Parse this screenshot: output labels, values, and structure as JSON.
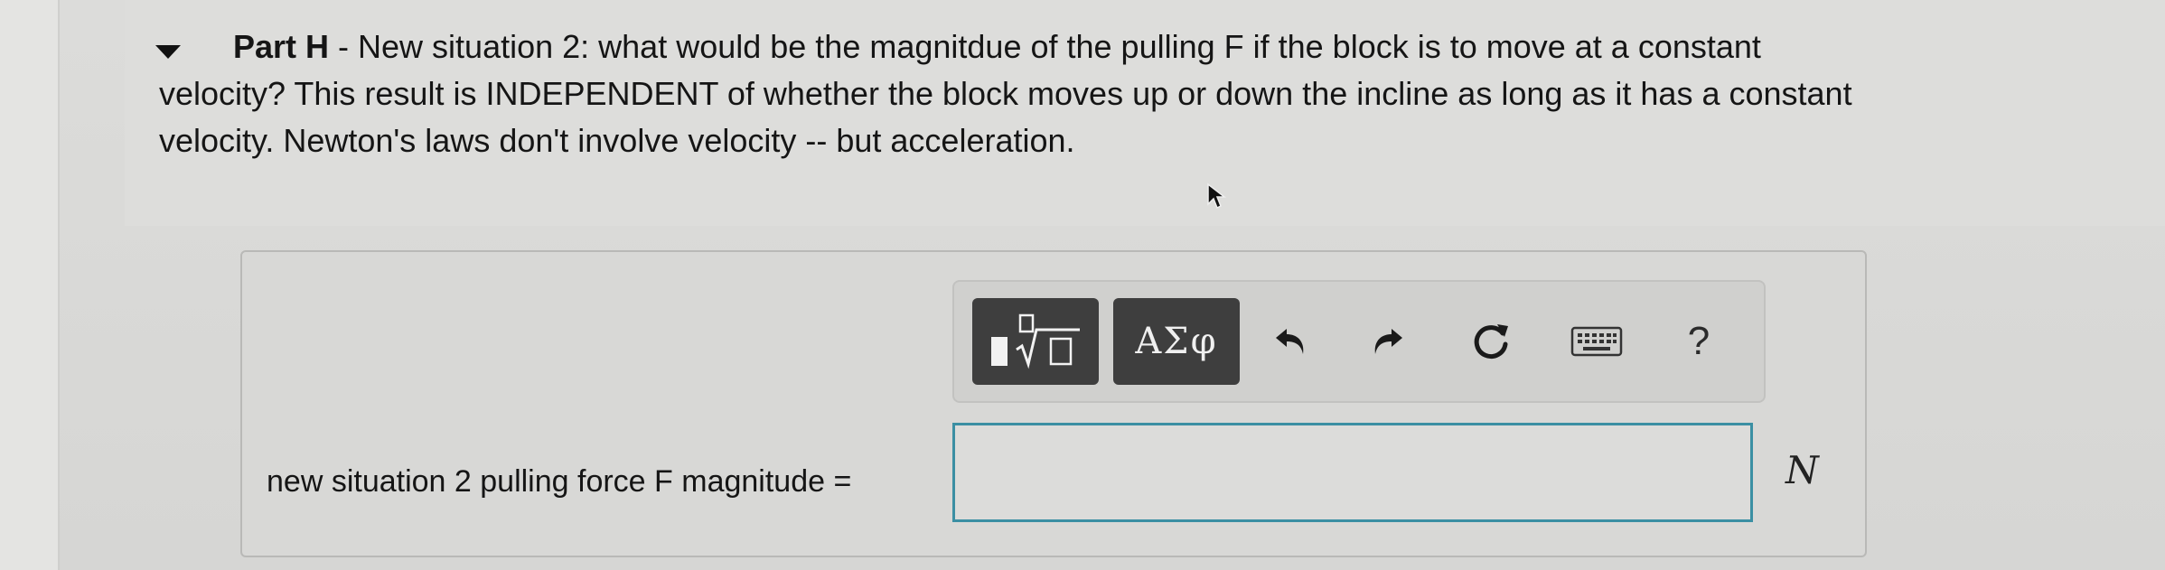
{
  "part": {
    "title": "Part H",
    "question_line1": " - New situation 2: what would be the magnitdue of the  pulling F if the block is to move at a constant",
    "question_line2": "velocity? This result is INDEPENDENT of whether the block moves up or down the incline as long as it has a constant",
    "question_line3": "velocity. Newton's laws don't involve velocity -- but acceleration."
  },
  "toolbar": {
    "templates_icon": "fraction-root-template-icon",
    "symbols_label": "ΑΣφ",
    "undo_icon": "undo-icon",
    "redo_icon": "redo-icon",
    "reset_icon": "reset-icon",
    "keyboard_icon": "keyboard-icon",
    "help_label": "?"
  },
  "answer": {
    "label": "new situation 2  pulling force F magnitude =",
    "value": "",
    "unit": "N"
  },
  "colors": {
    "input_border": "#3b8fa3",
    "toolbar_button": "#3e3e3e"
  }
}
